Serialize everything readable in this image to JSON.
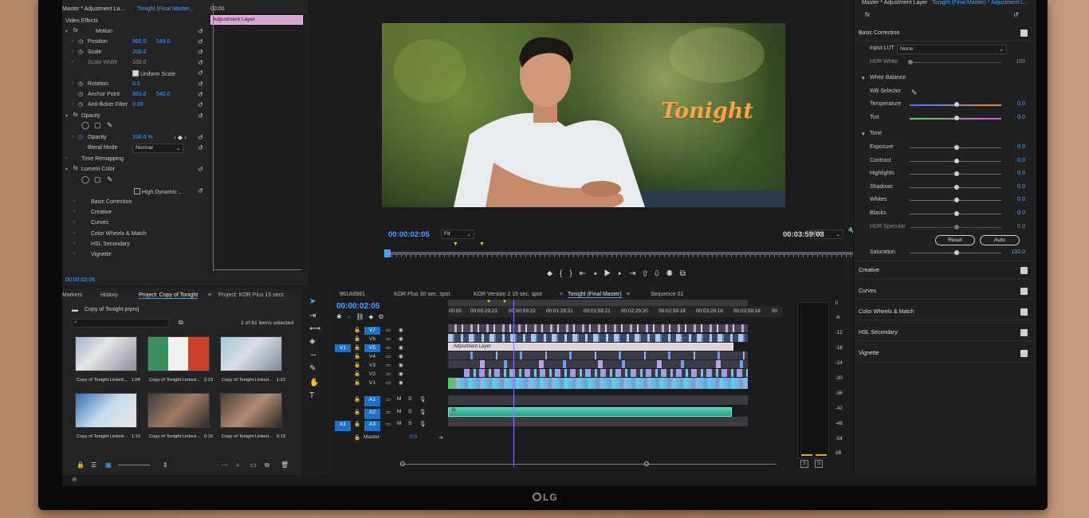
{
  "effect_controls": {
    "master_label": "Master * Adjustment La...",
    "sequence_label": "Tonight (Final Master...",
    "timecode_small": "00:00",
    "adjustment_clip": "Adjustment Layer",
    "video_effects": "Video Effects",
    "motion": "Motion",
    "position": {
      "label": "Position",
      "x": "960.0",
      "y": "540.0"
    },
    "scale": {
      "label": "Scale",
      "value": "100.0"
    },
    "scale_width": {
      "label": "Scale Width",
      "value": "100.0"
    },
    "uniform_scale": "Uniform Scale",
    "rotation": {
      "label": "Rotation",
      "value": "0.0"
    },
    "anchor_point": {
      "label": "Anchor Point",
      "x": "960.0",
      "y": "540.0"
    },
    "anti_flicker": {
      "label": "Anti-flicker Filter",
      "value": "0.00"
    },
    "opacity_section": "Opacity",
    "opacity": {
      "label": "Opacity",
      "value": "100.0 %"
    },
    "blend_mode": {
      "label": "Blend Mode",
      "value": "Normal"
    },
    "time_remapping": "Time Remapping",
    "lumetri_color": "Lumetri Color",
    "high_dynamic": "High Dynamic ...",
    "sub_items": [
      "Basic Correction",
      "Creative",
      "Curves",
      "Color Wheels & Match",
      "HSL Secondary",
      "Vignette"
    ],
    "footer_time": "00:00:02:05"
  },
  "program_monitor": {
    "title_overlay": "Tonight",
    "current_time": "00:00:02:05",
    "fit_label": "Fit",
    "full_label": "Full",
    "duration": "00:03:59:03"
  },
  "lumetri": {
    "master_label": "Master * Adjustment Layer",
    "sequence_label": "Tonight (Final Master) * Adjustment L...",
    "basic_correction": "Basic Correction",
    "input_lut": {
      "label": "Input LUT",
      "value": "None"
    },
    "hdr_white": {
      "label": "HDR White",
      "value": "100"
    },
    "white_balance": "White Balance",
    "wb_selector": "WB Selector",
    "temperature": {
      "label": "Temperature",
      "value": "0.0"
    },
    "tint": {
      "label": "Tint",
      "value": "0.0"
    },
    "tone": "Tone",
    "tone_rows": [
      {
        "label": "Exposure",
        "value": "0.0"
      },
      {
        "label": "Contrast",
        "value": "0.0"
      },
      {
        "label": "Highlights",
        "value": "0.0"
      },
      {
        "label": "Shadows",
        "value": "0.0"
      },
      {
        "label": "Whites",
        "value": "0.0"
      },
      {
        "label": "Blacks",
        "value": "0.0"
      }
    ],
    "hdr_specular": {
      "label": "HDR Specular",
      "value": "0.0"
    },
    "reset_label": "Reset",
    "auto_label": "Auto",
    "saturation": {
      "label": "Saturation",
      "value": "100.0"
    },
    "sections": [
      "Creative",
      "Curves",
      "Color Wheels & Match",
      "HSL Secondary",
      "Vignette"
    ]
  },
  "project": {
    "tabs": [
      "Markers",
      "History",
      "Project: Copy of Tonight",
      "Project: KOR Plus 15 secc"
    ],
    "file": "Copy of Tonight.prproj",
    "item_count": "1 of 61 items selected",
    "thumbs": [
      {
        "name": "Copy of Tonight Linked...",
        "duration": "1:04"
      },
      {
        "name": "Copy of Tonight Linked...",
        "duration": "2:19"
      },
      {
        "name": "Copy of Tonight Linked...",
        "duration": "1:22"
      },
      {
        "name": "Copy of Tonight Linked...",
        "duration": "1:10"
      },
      {
        "name": "Copy of Tonight Linked...",
        "duration": "0:16"
      },
      {
        "name": "Copy of Tonight Linked...",
        "duration": "0:19"
      }
    ]
  },
  "timeline": {
    "tabs": [
      "961A6981",
      "KOR Plus 30 sec. spot",
      "KOR Version 2 15 sec. spot",
      "Tonight (Final Master)",
      "Sequence 01"
    ],
    "current_time": "00:00:02:05",
    "ruler": [
      "00:00",
      "00:00:29:23",
      "00:00:59:22",
      "00:01:29:21",
      "00:01:59:21",
      "00:02:29:20",
      "00:02:59:19",
      "00:03:29:18",
      "00:03:59:18",
      "00"
    ],
    "video_tracks": [
      "V7",
      "V6",
      "V5",
      "V4",
      "V3",
      "V2",
      "V1"
    ],
    "audio_tracks": [
      "A1",
      "A2",
      "A3"
    ],
    "source_v": "V1",
    "source_a": "A1",
    "master_label": "Master",
    "master_value": "0.0",
    "adjustment_clip": "Adjustment Layer"
  },
  "meters": {
    "scale": [
      "0",
      "-6",
      "-12",
      "-18",
      "-24",
      "-30",
      "-36",
      "-42",
      "-48",
      "-54",
      "dB"
    ],
    "solo": [
      "S",
      "S"
    ]
  },
  "brand": "LG",
  "colors": {
    "accent": "#4aa3ff",
    "adjustment_clip": "#d9a3d2",
    "audio_clip": "#3fb8a3",
    "title_orange": "#f5a447"
  }
}
